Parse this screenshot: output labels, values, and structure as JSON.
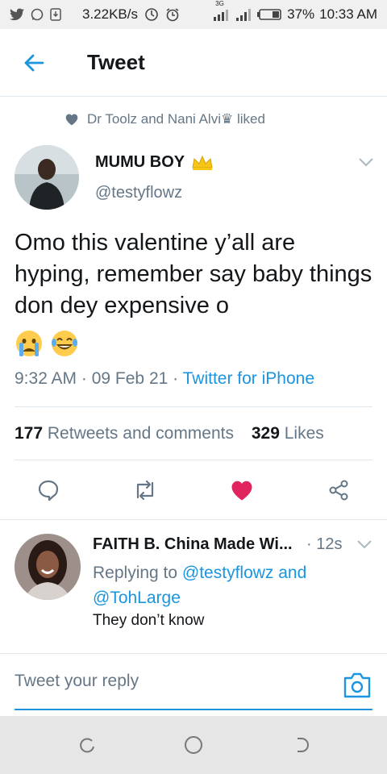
{
  "status_bar": {
    "speed": "3.22KB/s",
    "network_type": "3G",
    "battery": "37%",
    "time": "10:33 AM",
    "icons": [
      "twitter-icon",
      "whatsapp-icon",
      "download-icon",
      "sync-icon",
      "alarm-icon",
      "signal-icon",
      "signal-icon",
      "battery-icon"
    ]
  },
  "header": {
    "title": "Tweet",
    "back_icon": "arrow-left-icon"
  },
  "social_context": {
    "text": "Dr Toolz and Nani Alvi♛ liked"
  },
  "tweet": {
    "author_name": "MUMU BOY",
    "author_handle": "@testyflowz",
    "text": "Omo this valentine y’all are hyping, remember say baby things don dey expensive o",
    "emojis": [
      "crying-face-emoji",
      "laughing-tears-emoji"
    ],
    "time": "9:32 AM",
    "date": "09 Feb 21",
    "source": "Twitter for iPhone",
    "retweets_count": "177",
    "retweets_label": "Retweets and comments",
    "likes_count": "329",
    "likes_label": "Likes",
    "liked": true
  },
  "reply": {
    "author_name": "FAITH B. China Made Wi...",
    "time": "12s",
    "replying_prefix": "Replying to",
    "replying_handles": "@testyflowz and @TohLarge",
    "text": "They don’t know"
  },
  "reply_bar": {
    "placeholder": "Tweet your reply"
  },
  "colors": {
    "accent": "#1b95e0",
    "like": "#e0245e",
    "muted": "#657786"
  }
}
